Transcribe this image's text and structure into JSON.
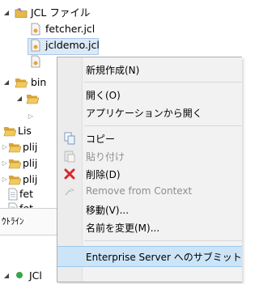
{
  "tree": {
    "root_label": "JCL ファイル",
    "files": [
      "fetcher.jcl",
      "jcldemo.jcl"
    ],
    "bin_label": "bin",
    "lis_label": "Lis",
    "plij_labels": [
      "plij",
      "plij",
      "plij"
    ],
    "fet_labels": [
      "fet",
      "fet"
    ],
    "bottom_label": "JCl"
  },
  "outline": {
    "label": "ｳﾄﾗｲﾝ"
  },
  "menu": {
    "items": [
      {
        "label": "新規作成(N)",
        "disabled": false
      },
      {
        "label": "開く(O)",
        "disabled": false
      },
      {
        "label": "アプリケーションから開く",
        "disabled": false
      },
      {
        "label": "コピー",
        "disabled": false
      },
      {
        "label": "貼り付け",
        "disabled": true
      },
      {
        "label": "削除(D)",
        "disabled": false
      },
      {
        "label": "Remove from Context",
        "disabled": true
      },
      {
        "label": "移動(V)...",
        "disabled": false
      },
      {
        "label": "名前を変更(M)...",
        "disabled": false
      },
      {
        "label": "Enterprise Server へのサブミット",
        "disabled": false
      }
    ]
  },
  "colors": {
    "folder": "#e8b84a",
    "selection": "#dbe9f7",
    "menu_highlight": "#cce4f7",
    "delete_red": "#d9262b"
  }
}
